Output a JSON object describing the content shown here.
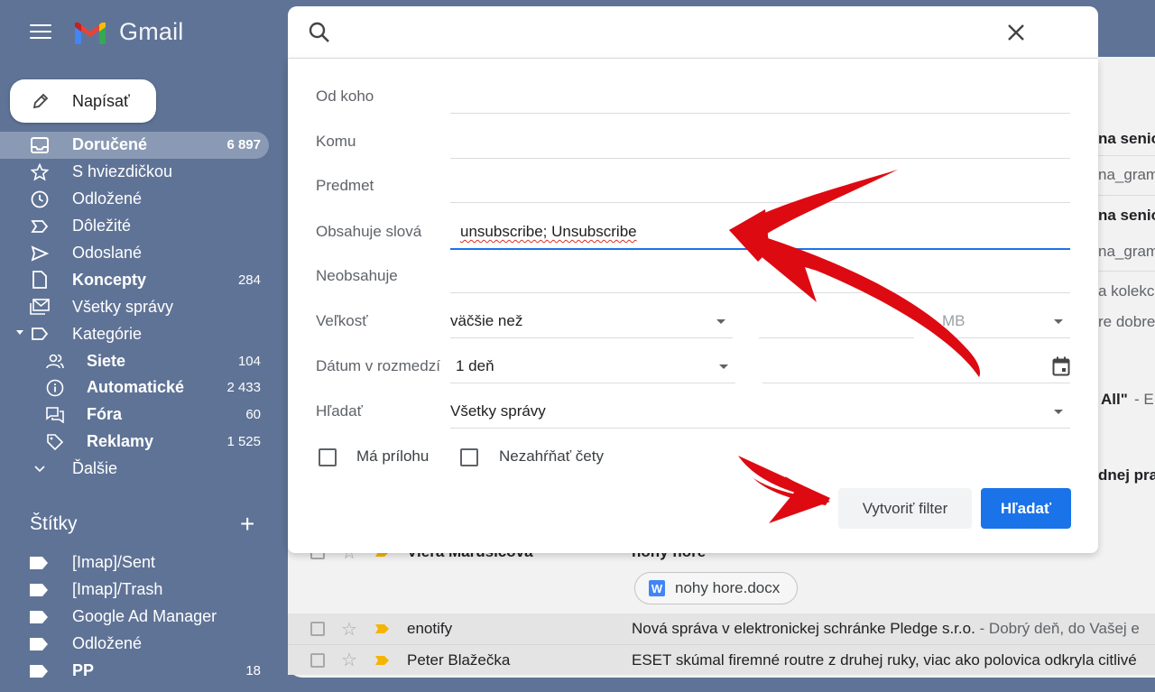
{
  "app": {
    "logo_text": "Gmail"
  },
  "compose": {
    "label": "Napísať"
  },
  "nav": [
    {
      "label": "Doručené",
      "count": "6 897",
      "icon": "inbox-icon"
    },
    {
      "label": "S hviezdičkou",
      "count": "",
      "icon": "star-icon"
    },
    {
      "label": "Odložené",
      "count": "",
      "icon": "clock-icon"
    },
    {
      "label": "Dôležité",
      "count": "",
      "icon": "important-icon"
    },
    {
      "label": "Odoslané",
      "count": "",
      "icon": "send-icon"
    },
    {
      "label": "Koncepty",
      "count": "284",
      "icon": "draft-icon"
    },
    {
      "label": "Všetky správy",
      "count": "",
      "icon": "all-mail-icon"
    },
    {
      "label": "Kategórie",
      "count": "",
      "icon": "category-icon"
    },
    {
      "label": "Siete",
      "count": "104",
      "icon": "social-icon"
    },
    {
      "label": "Automatické",
      "count": "2 433",
      "icon": "info-icon"
    },
    {
      "label": "Fóra",
      "count": "60",
      "icon": "forum-icon"
    },
    {
      "label": "Reklamy",
      "count": "1 525",
      "icon": "promo-tag-icon"
    },
    {
      "label": "Ďalšie",
      "count": "",
      "icon": "chevron-down-icon"
    }
  ],
  "labels_section": {
    "title": "Štítky",
    "add": "+"
  },
  "labels": [
    {
      "label": "[Imap]/Sent",
      "count": ""
    },
    {
      "label": "[Imap]/Trash",
      "count": ""
    },
    {
      "label": "Google Ad Manager",
      "count": ""
    },
    {
      "label": "Odložené",
      "count": ""
    },
    {
      "label": "PP",
      "count": "18"
    }
  ],
  "search": {
    "fields": {
      "from": "Od koho",
      "to": "Komu",
      "subject": "Predmet",
      "has_words": "Obsahuje slová",
      "has_words_value": "unsubscribe; Unsubscribe",
      "doesnt_have": "Neobsahuje",
      "size": "Veľkosť",
      "size_op": "väčšie než",
      "size_unit": "MB",
      "date": "Dátum v rozmedzí",
      "date_range": "1 deň",
      "search_in": "Hľadať",
      "search_in_value": "Všetky správy"
    },
    "has_attachment": "Má prílohu",
    "exclude_chats": "Nezahŕňať čety",
    "create_filter": "Vytvoriť filter",
    "search_button": "Hľadať"
  },
  "background_fragments": [
    "na senio",
    "na_gram",
    "na senio",
    "na_gram",
    "a kolekci",
    "re dobre",
    "All\"",
    "- EF",
    "dnej pra"
  ],
  "mail": {
    "partial_row": {
      "sender": "Viera Marušicová",
      "subject": "nohy hore"
    },
    "attachment": "nohy hore.docx",
    "rows": [
      {
        "sender": "enotify",
        "subject": "Nová správa v elektronickej schránke Pledge s.r.o.",
        "snippet": " - Dobrý deň, do Vašej e"
      },
      {
        "sender": "Peter Blažečka",
        "subject": "ESET skúmal firemné routre z druhej ruky, viac ako polovica odkryla citlivé",
        "snippet": ""
      }
    ]
  }
}
